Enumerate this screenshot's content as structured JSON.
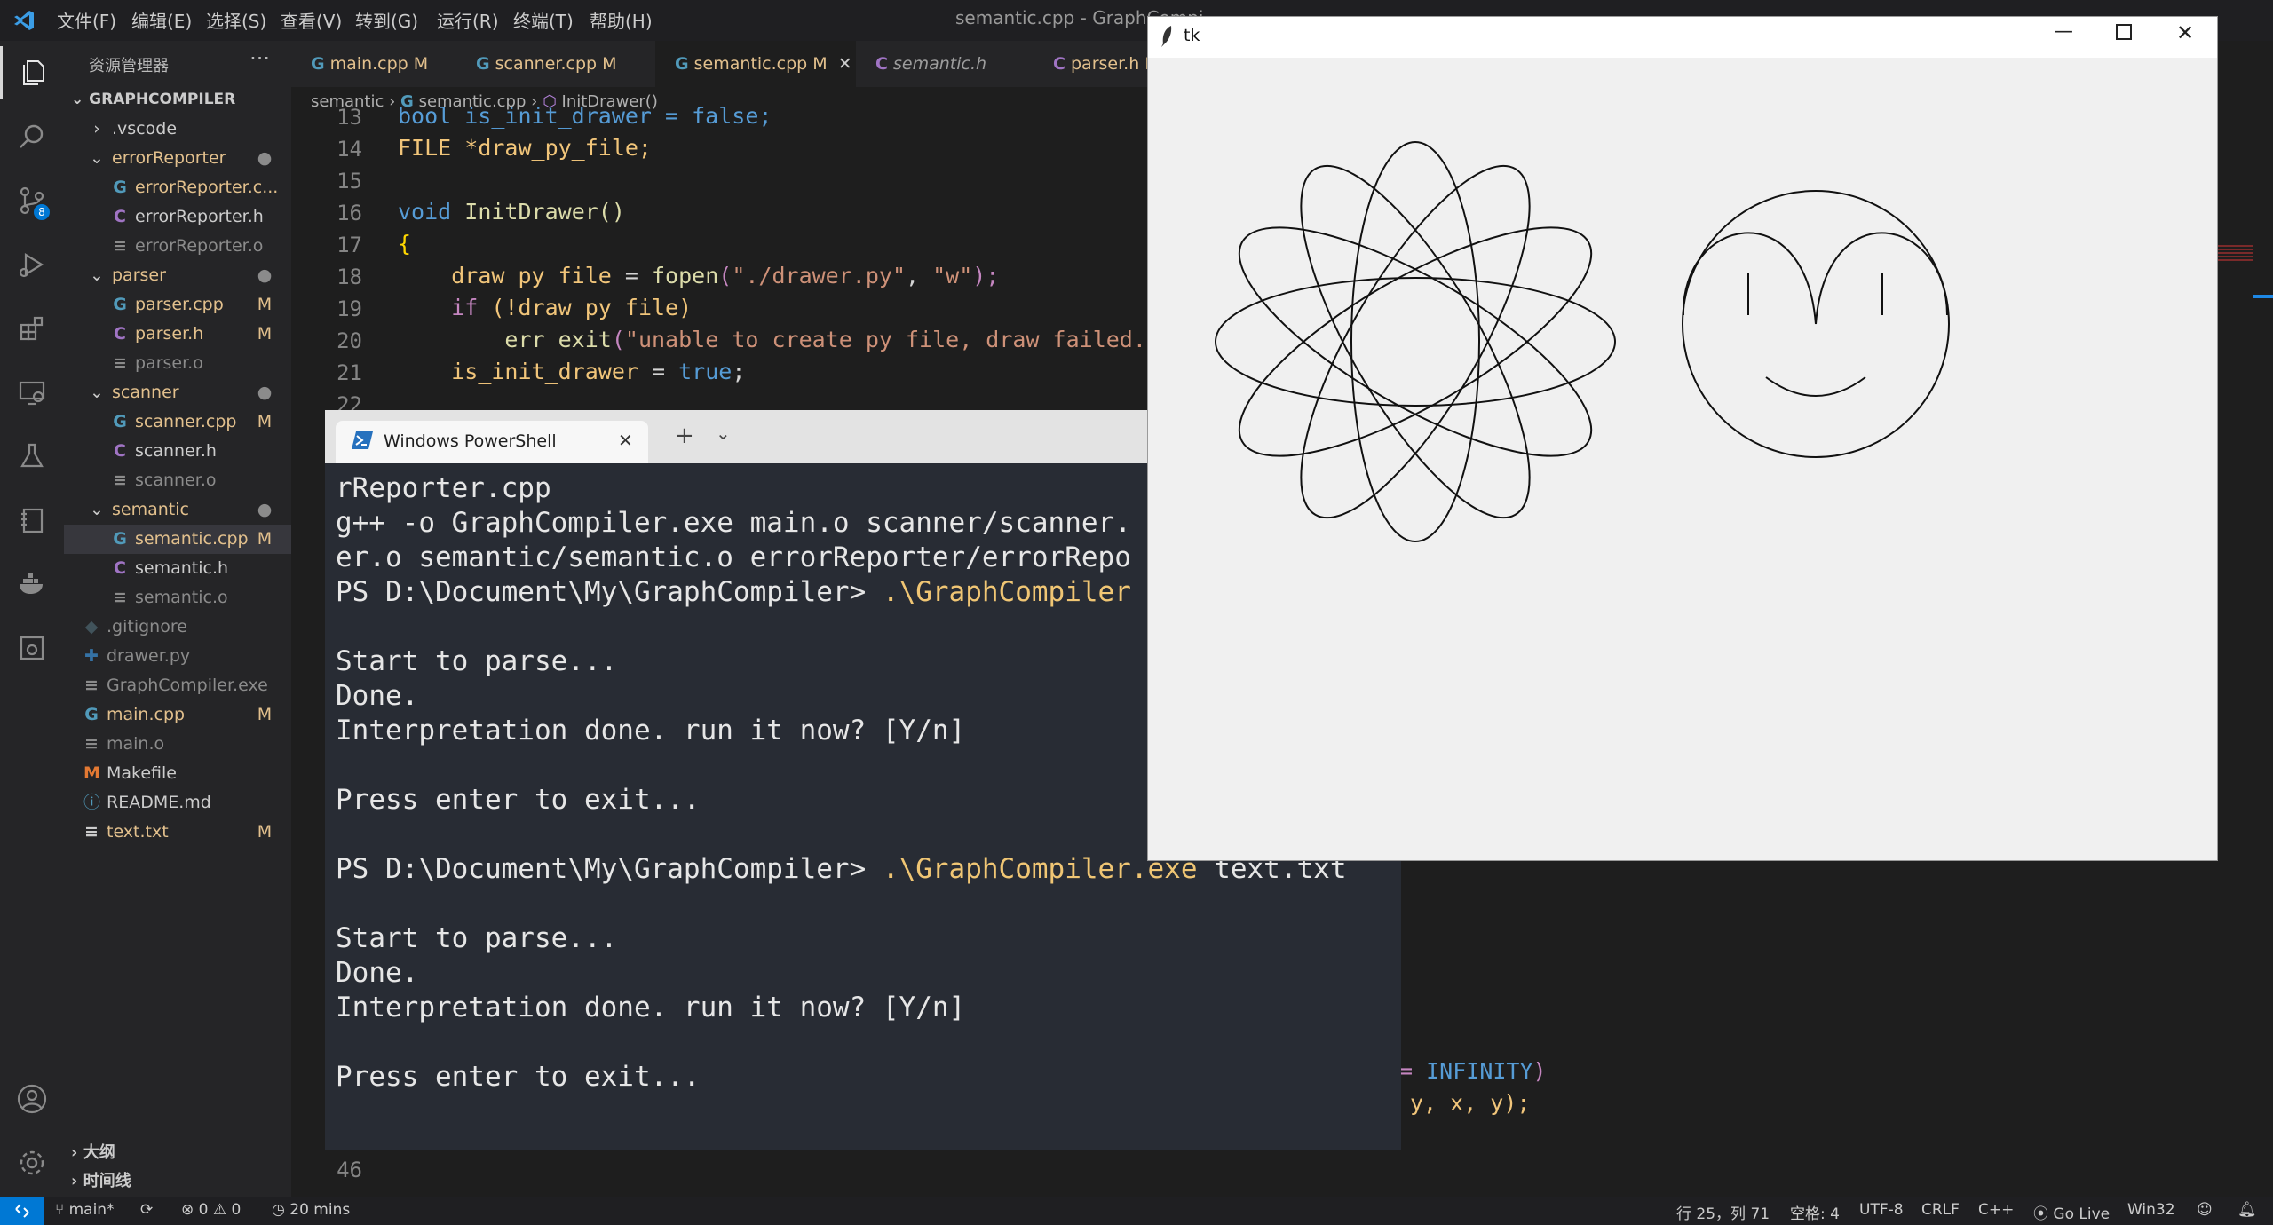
{
  "titlebar": {
    "menus": [
      "文件(F)",
      "编辑(E)",
      "选择(S)",
      "查看(V)",
      "转到(G)",
      "运行(R)",
      "终端(T)",
      "帮助(H)"
    ],
    "title": "semantic.cpp - GraphCompi"
  },
  "sidebar": {
    "header": "资源管理器",
    "root": "GRAPHCOMPILER",
    "scm_badge": "8",
    "items": [
      {
        "label": ".vscode",
        "mark": ""
      },
      {
        "label": "errorReporter",
        "mark": ""
      },
      {
        "label": "errorReporter.c...",
        "mark": "M"
      },
      {
        "label": "errorReporter.h",
        "mark": ""
      },
      {
        "label": "errorReporter.o",
        "mark": ""
      },
      {
        "label": "parser",
        "mark": ""
      },
      {
        "label": "parser.cpp",
        "mark": "M"
      },
      {
        "label": "parser.h",
        "mark": "M"
      },
      {
        "label": "parser.o",
        "mark": ""
      },
      {
        "label": "scanner",
        "mark": ""
      },
      {
        "label": "scanner.cpp",
        "mark": "M"
      },
      {
        "label": "scanner.h",
        "mark": ""
      },
      {
        "label": "scanner.o",
        "mark": ""
      },
      {
        "label": "semantic",
        "mark": ""
      },
      {
        "label": "semantic.cpp",
        "mark": "M"
      },
      {
        "label": "semantic.h",
        "mark": ""
      },
      {
        "label": "semantic.o",
        "mark": ""
      },
      {
        "label": ".gitignore",
        "mark": ""
      },
      {
        "label": "drawer.py",
        "mark": ""
      },
      {
        "label": "GraphCompiler.exe",
        "mark": ""
      },
      {
        "label": "main.cpp",
        "mark": "M"
      },
      {
        "label": "main.o",
        "mark": ""
      },
      {
        "label": "Makefile",
        "mark": ""
      },
      {
        "label": "README.md",
        "mark": ""
      },
      {
        "label": "text.txt",
        "mark": "M"
      }
    ],
    "outline": "大纲",
    "timeline": "时间线"
  },
  "tabs": [
    {
      "label": "main.cpp",
      "mark": "M"
    },
    {
      "label": "scanner.cpp",
      "mark": "M"
    },
    {
      "label": "semantic.cpp",
      "mark": "M"
    },
    {
      "label": "semantic.h",
      "mark": ""
    },
    {
      "label": "parser.h",
      "mark": "M"
    }
  ],
  "breadcrumb": [
    "semantic",
    "semantic.cpp",
    "InitDrawer()"
  ],
  "editor": {
    "line_numbers": [
      "13",
      "14",
      "15",
      "16",
      "17",
      "18",
      "19",
      "20",
      "21",
      "22",
      "46"
    ],
    "line13": "bool is_init_drawer = false;",
    "file_kw": "FILE",
    "line14_rest": " *draw_py_file;",
    "void_kw": "void",
    "fn_name": "InitDrawer",
    "parens": "()",
    "brace": "{",
    "v_draw": "draw_py_file",
    "eq": " = ",
    "fopen": "fopen",
    "fopen_args_1": "(",
    "str_path": "\"./drawer.py\"",
    "comma": ", ",
    "str_w": "\"w\"",
    "fopen_close": ");",
    "if_kw": "if",
    "if_cond": " (!draw_py_file)",
    "err_fn": "err_exit",
    "err_open": "(",
    "err_str": "\"unable to create py file, draw failed.\"",
    "v_init": "is_init_drawer",
    "true_kw": "true",
    "semi": ";",
    "frag_infinity_eq": "= ",
    "frag_infinity": "INFINITY",
    "frag_infinity_close": ")",
    "frag_xy": "y, x, y);"
  },
  "powershell": {
    "tab_title": "Windows PowerShell",
    "lines": [
      {
        "pre": "rReporter.cpp",
        "hl": "",
        "post": ""
      },
      {
        "pre": "g++ -o GraphCompiler.exe main.o scanner/scanner.",
        "hl": "",
        "post": ""
      },
      {
        "pre": "er.o semantic/semantic.o errorReporter/errorRepo",
        "hl": "",
        "post": ""
      },
      {
        "pre": "PS D:\\Document\\My\\GraphCompiler> ",
        "hl": ".\\GraphCompiler",
        "post": ""
      },
      {
        "pre": "",
        "hl": "",
        "post": ""
      },
      {
        "pre": "Start to parse...",
        "hl": "",
        "post": ""
      },
      {
        "pre": "Done.",
        "hl": "",
        "post": ""
      },
      {
        "pre": "Interpretation done. run it now? [Y/n]",
        "hl": "",
        "post": ""
      },
      {
        "pre": "",
        "hl": "",
        "post": ""
      },
      {
        "pre": "Press enter to exit...",
        "hl": "",
        "post": ""
      },
      {
        "pre": "",
        "hl": "",
        "post": ""
      },
      {
        "pre": "PS D:\\Document\\My\\GraphCompiler> ",
        "hl": ".\\GraphCompiler.exe",
        "post": " text.txt"
      },
      {
        "pre": "",
        "hl": "",
        "post": ""
      },
      {
        "pre": "Start to parse...",
        "hl": "",
        "post": ""
      },
      {
        "pre": "Done.",
        "hl": "",
        "post": ""
      },
      {
        "pre": "Interpretation done. run it now? [Y/n]",
        "hl": "",
        "post": ""
      },
      {
        "pre": "",
        "hl": "",
        "post": ""
      },
      {
        "pre": "Press enter to exit...",
        "hl": "",
        "post": ""
      }
    ]
  },
  "tk": {
    "title": "tk"
  },
  "status": {
    "branch": "main*",
    "problems": "⊗ 0 ⚠ 0",
    "time": "20 mins",
    "position": "行 25，列 71",
    "spaces": "空格: 4",
    "encoding": "UTF-8",
    "eol": "CRLF",
    "language": "C++",
    "golive": "Go Live",
    "platform": "Win32"
  },
  "colors": {
    "accent": "#0078d4",
    "modified": "#e2c08d",
    "keyword": "#569cd6",
    "function": "#dcdcaa",
    "string": "#ce9178"
  }
}
